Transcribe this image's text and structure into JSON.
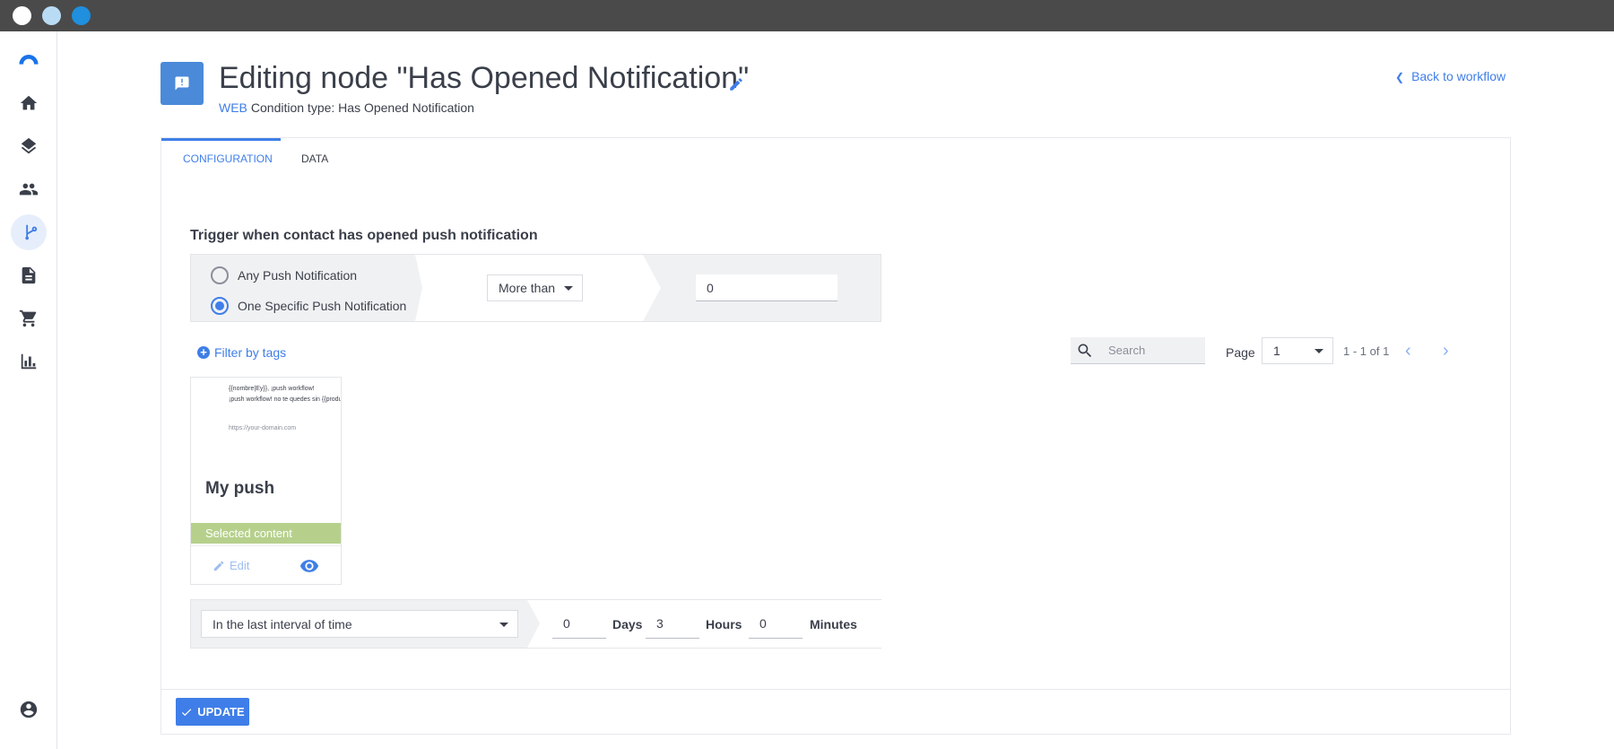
{
  "window": {
    "dots": [
      {
        "color": "#ffffff"
      },
      {
        "color": "#b9dcf4"
      },
      {
        "color": "#1f8fde"
      }
    ]
  },
  "sidebar": {
    "items": [
      {
        "name": "app-logo",
        "active": false
      },
      {
        "name": "home-icon",
        "active": false
      },
      {
        "name": "layers-icon",
        "active": false
      },
      {
        "name": "contacts-icon",
        "active": false
      },
      {
        "name": "workflow-icon",
        "active": true
      },
      {
        "name": "document-icon",
        "active": false
      },
      {
        "name": "cart-icon",
        "active": false
      },
      {
        "name": "analytics-icon",
        "active": false
      },
      {
        "name": "account-icon",
        "active": false
      }
    ]
  },
  "header": {
    "title": "Editing node \"Has Opened Notification\"",
    "channel": "WEB",
    "condition": "Condition type: Has Opened Notification",
    "back_label": "Back to workflow"
  },
  "tabs": [
    {
      "label": "CONFIGURATION",
      "active": true
    },
    {
      "label": "DATA",
      "active": false
    }
  ],
  "trigger": {
    "title": "Trigger when contact has opened push notification",
    "options": [
      {
        "label": "Any Push Notification",
        "checked": false
      },
      {
        "label": "One Specific Push Notification",
        "checked": true
      }
    ],
    "comparator": "More than",
    "count": "0"
  },
  "filter": {
    "label": "Filter by tags"
  },
  "search": {
    "placeholder": "Search"
  },
  "pagination": {
    "label": "Page",
    "page": "1",
    "range": "1 - 1 of 1"
  },
  "push_card": {
    "preview_line1": "{{nombre|Ey}}, ¡push workflow!",
    "preview_line2": "¡push workflow! no te quedes sin {{producto}}",
    "preview_url": "https://your-domain.com",
    "name": "My push",
    "selected_label": "Selected content",
    "edit_label": "Edit"
  },
  "interval": {
    "mode": "In the last interval of time",
    "days": "0",
    "days_label": "Days",
    "hours": "3",
    "hours_label": "Hours",
    "minutes": "0",
    "minutes_label": "Minutes"
  },
  "actions": {
    "update_label": "UPDATE"
  },
  "colors": {
    "accent": "#3f7ee8",
    "selected": "#b6d08c",
    "titlebar": "#4a4a4a"
  }
}
